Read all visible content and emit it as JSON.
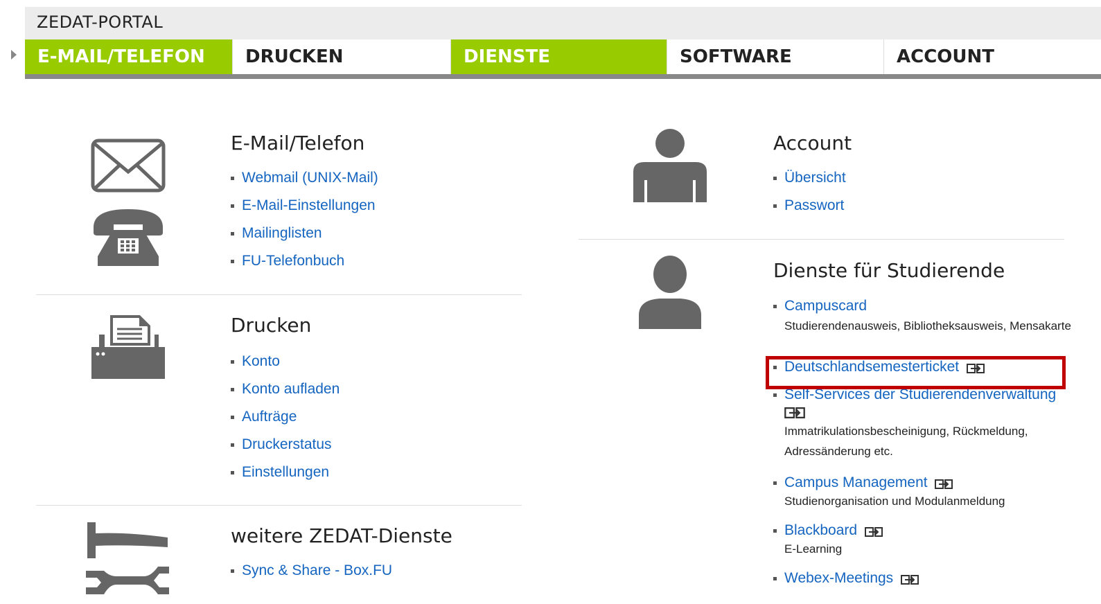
{
  "portal_title": "ZEDAT-PORTAL",
  "nav": {
    "tabs": [
      {
        "label": "E-MAIL/TELEFON",
        "active": true
      },
      {
        "label": "DRUCKEN",
        "active": false
      },
      {
        "label": "DIENSTE",
        "active": true
      },
      {
        "label": "SOFTWARE",
        "active": false
      },
      {
        "label": "ACCOUNT",
        "active": false
      }
    ]
  },
  "email_section": {
    "title": "E-Mail/Telefon",
    "icons": [
      "envelope-icon",
      "telephone-icon"
    ],
    "links": [
      "Webmail (UNIX-Mail)",
      "E-Mail-Einstellungen",
      "Mailinglisten",
      "FU-Telefonbuch"
    ]
  },
  "drucken_section": {
    "title": "Drucken",
    "icons": [
      "printer-icon"
    ],
    "links": [
      "Konto",
      "Konto aufladen",
      "Aufträge",
      "Druckerstatus",
      "Einstellungen"
    ]
  },
  "weitere_section": {
    "title": "weitere ZEDAT-Dienste",
    "icons": [
      "tools-icon"
    ],
    "links": [
      "Sync & Share - Box.FU"
    ]
  },
  "account_section": {
    "title": "Account",
    "icons": [
      "person-icon"
    ],
    "links": [
      "Übersicht",
      "Passwort"
    ]
  },
  "dienste_section": {
    "title": "Dienste für Studierende",
    "icons": [
      "student-icon",
      "external-link-icon"
    ],
    "items": [
      {
        "label": "Campuscard",
        "desc": "Studierendenausweis, Bibliotheksausweis, Mensakarte",
        "external": false
      },
      {
        "label": "Deutschlandsemesterticket",
        "desc": "",
        "external": true,
        "highlighted": true
      },
      {
        "label": "Self-Services der Studierendenverwaltung",
        "desc": "Immatrikulationsbescheinigung, Rückmeldung, Adressänderung etc.",
        "external": true
      },
      {
        "label": "Campus Management",
        "desc": "Studienorganisation und Modulanmeldung",
        "external": true
      },
      {
        "label": "Blackboard",
        "desc": "E-Learning",
        "external": true
      },
      {
        "label": "Webex-Meetings",
        "desc": "",
        "external": true
      }
    ]
  },
  "colors": {
    "accent_green": "#99cc00",
    "link_blue": "#1565c0",
    "highlight_red": "#c00000",
    "icon_gray": "#666666"
  }
}
